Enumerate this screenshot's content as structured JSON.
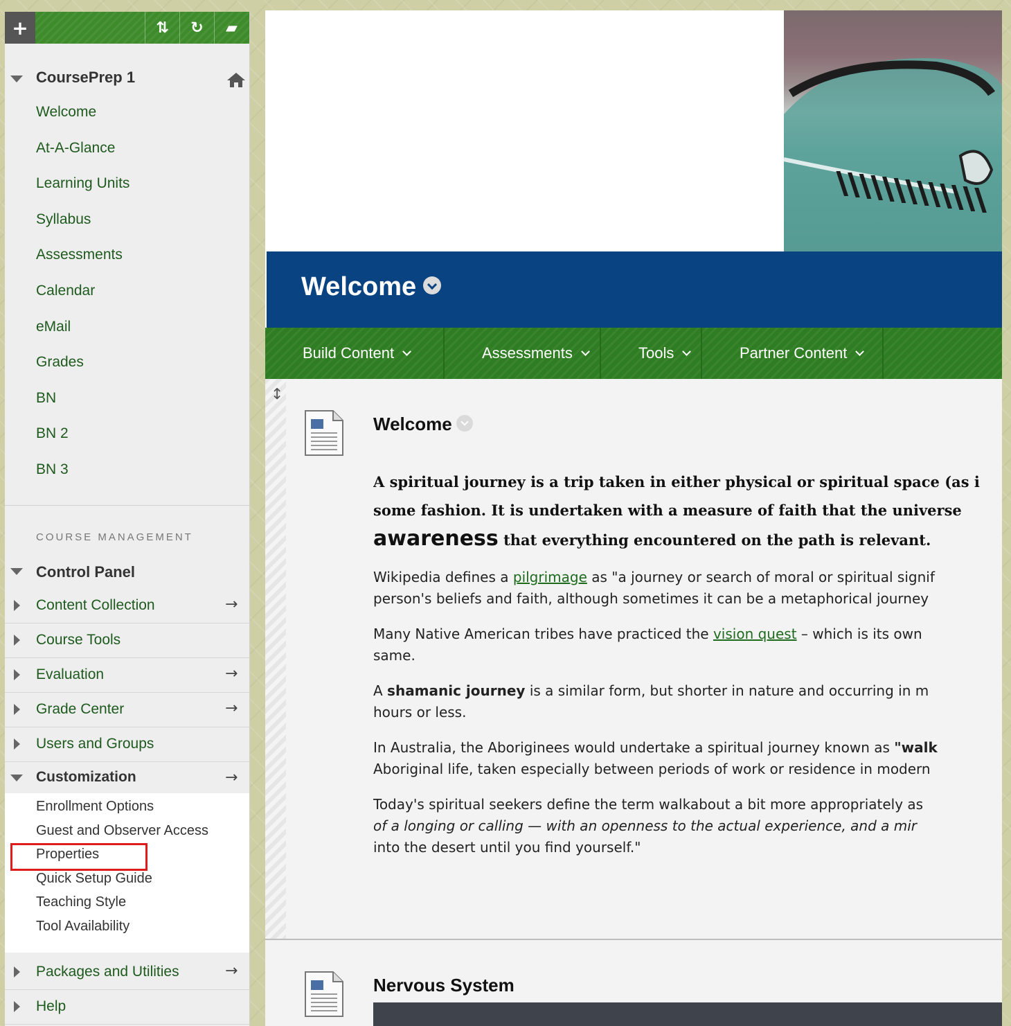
{
  "sidebar": {
    "toolbar": {
      "add": "+",
      "sort": "⇅",
      "refresh": "↻",
      "folder": "▰"
    },
    "course_title": "CoursePrep 1",
    "course_menu": [
      "Welcome",
      "At-A-Glance",
      "Learning Units",
      "Syllabus",
      "Assessments",
      "Calendar",
      "eMail",
      "Grades",
      "BN",
      "BN 2",
      "BN 3"
    ],
    "course_management_label": "COURSE MANAGEMENT",
    "control_panel_label": "Control Panel",
    "control_panel_items": [
      {
        "label": "Content Collection",
        "arrow": "→"
      },
      {
        "label": "Course Tools",
        "arrow": ""
      },
      {
        "label": "Evaluation",
        "arrow": "→"
      },
      {
        "label": "Grade Center",
        "arrow": "→"
      },
      {
        "label": "Users and Groups",
        "arrow": ""
      }
    ],
    "customization": {
      "label": "Customization",
      "arrow": "→",
      "items": [
        "Enrollment Options",
        "Guest and Observer Access",
        "Properties",
        "Quick Setup Guide",
        "Teaching Style",
        "Tool Availability"
      ]
    },
    "bottom_items": [
      {
        "label": "Packages and Utilities",
        "arrow": "→"
      },
      {
        "label": "Help",
        "arrow": ""
      }
    ]
  },
  "main": {
    "page_title": "Welcome",
    "action_bar": [
      "Build Content",
      "Assessments",
      "Tools",
      "Partner Content"
    ],
    "item1": {
      "title": "Welcome",
      "lead_line1": "A spiritual journey is a trip taken in either physical or spiritual space (as i",
      "lead_line2": "some fashion.  It is undertaken with a measure of faith that the universe",
      "lead_big": "awareness",
      "lead_line3_rest": " that everything encountered on the path is relevant.",
      "p1_a": "Wikipedia defines a ",
      "p1_link": "pilgrimage",
      "p1_b": " as \"a journey or search of moral or spiritual signif",
      "p1_line2": "person's beliefs and faith, although sometimes it can be a metaphorical journey",
      "p2_a": "Many Native American tribes have practiced the ",
      "p2_link": "vision quest",
      "p2_b": " – which is its own",
      "p2_line2": "same.",
      "p3_a": "A ",
      "p3_bold": "shamanic journey",
      "p3_b": " is a similar form, but shorter in nature and occurring in m",
      "p3_line2": "hours or less.",
      "p4_a": "In Australia, the Aboriginees would undertake a spiritual journey known as ",
      "p4_bold": "\"walk",
      "p4_line2": "Aboriginal life, taken especially between periods of work or residence in modern",
      "p5_line1": "Today's spiritual seekers define the term walkabout a bit more appropriately as",
      "p5_italic": "of a longing or calling — with an openness to the actual experience, and  a mir",
      "p5_line3": "into the desert until you find yourself.\""
    },
    "item2": {
      "title": "Nervous System"
    }
  },
  "colors": {
    "header_blue": "#0a4382",
    "action_green": "#2f7d22",
    "link_green": "#1e5a1e",
    "highlight_red": "#e01b1b"
  }
}
